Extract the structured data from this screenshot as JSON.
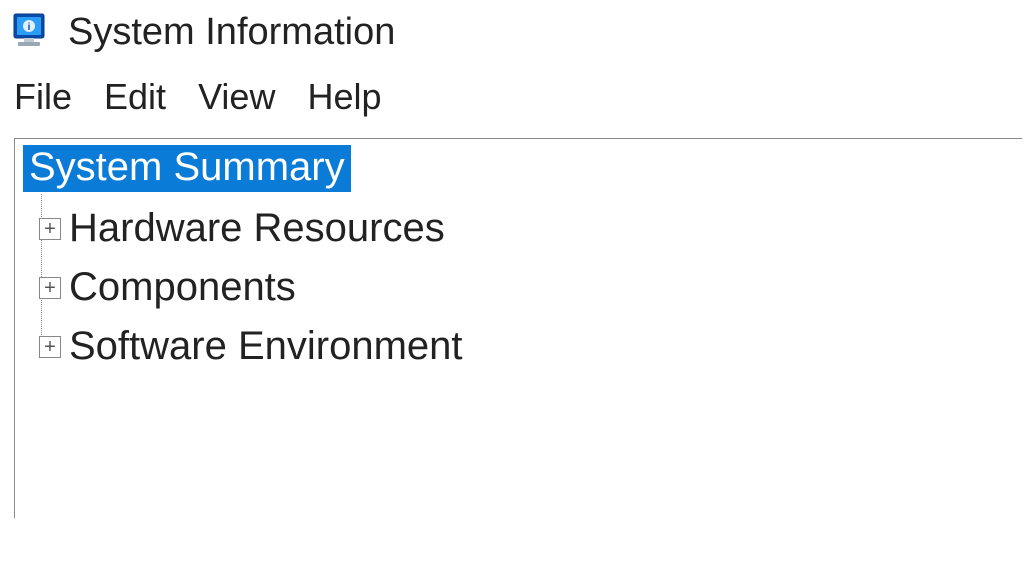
{
  "title": "System Information",
  "menu": {
    "file": "File",
    "edit": "Edit",
    "view": "View",
    "help": "Help"
  },
  "tree": {
    "root": "System Summary",
    "items": [
      "Hardware Resources",
      "Components",
      "Software Environment"
    ]
  },
  "expand_symbol": "+"
}
